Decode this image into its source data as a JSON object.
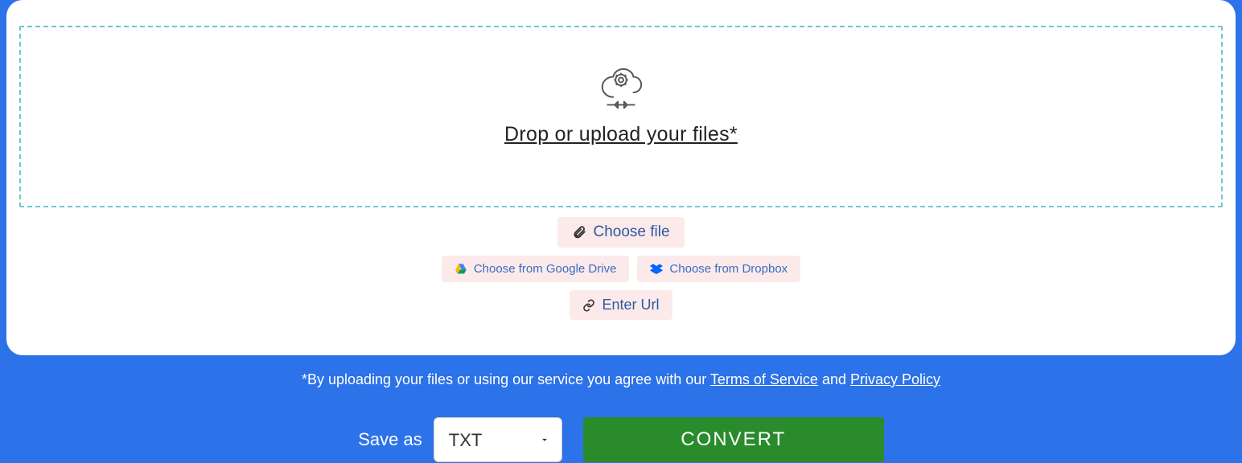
{
  "dropzone": {
    "heading": "Drop or upload your files*"
  },
  "buttons": {
    "choose_file": "Choose file",
    "google_drive": "Choose from Google Drive",
    "dropbox": "Choose from Dropbox",
    "enter_url": "Enter Url"
  },
  "disclaimer": {
    "prefix": "*By uploading your files or using our service you agree with our ",
    "terms": "Terms of Service",
    "mid": " and ",
    "privacy": "Privacy Policy"
  },
  "action": {
    "save_as_label": "Save as",
    "format_selected": "TXT",
    "convert_label": "CONVERT"
  }
}
